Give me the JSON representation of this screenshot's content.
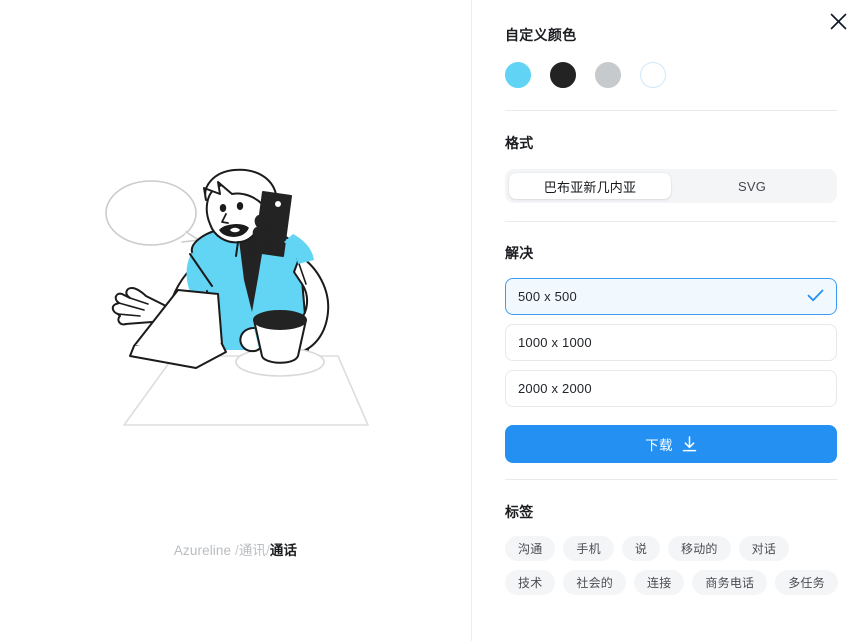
{
  "preview": {
    "illustration_name": "man-on-phone-call-at-desk-illustration",
    "breadcrumb": {
      "brand": "Azureline",
      "separator_1": " /",
      "category": "通讯",
      "separator_2": "/",
      "current": "通话"
    }
  },
  "panel": {
    "close_icon": "close-icon",
    "colors": {
      "title": "自定义颜色",
      "swatches": [
        {
          "name": "cyan",
          "hex": "#61D4F5",
          "border": "#61D4F5",
          "selected": true
        },
        {
          "name": "black",
          "hex": "#232323",
          "border": "#232323",
          "selected": false
        },
        {
          "name": "gray",
          "hex": "#C7CACD",
          "border": "#C7CACD",
          "selected": false
        },
        {
          "name": "white",
          "hex": "#FFFFFF",
          "border": "#CFE8FA",
          "selected": false
        }
      ]
    },
    "format": {
      "title": "格式",
      "options": [
        {
          "label": "巴布亚新几内亚",
          "active": true
        },
        {
          "label": "SVG",
          "active": false
        }
      ]
    },
    "resolution": {
      "title": "解决",
      "options": [
        {
          "label": "500 x 500",
          "selected": true
        },
        {
          "label": "1000 x 1000",
          "selected": false
        },
        {
          "label": "2000 x 2000",
          "selected": false
        }
      ],
      "download_label": "下载",
      "download_icon": "download-icon",
      "download_color": "#2491F2"
    },
    "tags": {
      "title": "标签",
      "items": [
        "沟通",
        "手机",
        "说",
        "移动的",
        "对话",
        "技术",
        "社会的",
        "连接",
        "商务电话",
        "多任务"
      ]
    }
  }
}
